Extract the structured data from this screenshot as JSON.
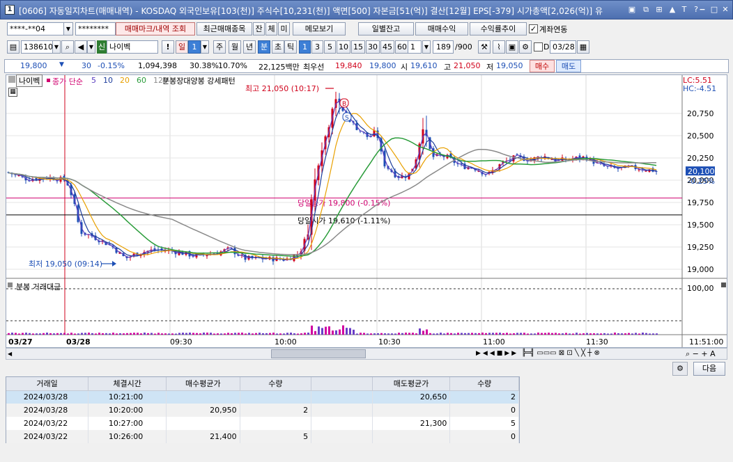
{
  "window": {
    "number": "1",
    "title": "[0606] 자동일지차트(매매내역) - KOSDAQ 외국인보유[103(천)] 주식수[10,231(천)] 액면[500] 자본금[51(억)] 결산[12월] EPS[-379] 시가총액[2,026(억)] 유"
  },
  "toolbar1": {
    "account": "****-**04",
    "password": "********",
    "mark_btn": "매매마크/내역 조회",
    "recent_btn": "최근매매종목",
    "jan": "잔",
    "che": "체",
    "mi": "미",
    "memo": "메모보기",
    "daily_balance": "일별잔고",
    "trade_profit": "매매수익",
    "profit_trend": "수익률추이",
    "account_link": "계좌연동"
  },
  "toolbar2": {
    "code": "138610",
    "credit": "신",
    "stock_name": "나이벡",
    "alert": "!",
    "il": "일",
    "il_num": "1",
    "ju": "주",
    "wol": "월",
    "nyeon": "년",
    "bun": "분",
    "cho": "초",
    "tik": "틱",
    "periods": [
      "1",
      "3",
      "5",
      "10",
      "15",
      "30",
      "45",
      "60"
    ],
    "period_sel": "1",
    "count": "189",
    "count_total": "/900",
    "d_label": "D",
    "date": "03/28"
  },
  "quote": {
    "price": "19,800",
    "change_arrow": "▼",
    "change": "30",
    "rate": "-0.15%",
    "volume": "1,094,398",
    "turnover_rate": "30.38%",
    "vol_power": "10.70%",
    "amount": "22,125백만",
    "best_label": "최우선",
    "best_ask": "19,840",
    "best_bid": "19,800",
    "open_label": "시",
    "open": "19,610",
    "high_label": "고",
    "high": "21,050",
    "low_label": "저",
    "low": "19,050",
    "buy": "매수",
    "sell": "매도"
  },
  "chart": {
    "name_tag": "나이벡",
    "legend_close": "종가 단순",
    "ma": [
      {
        "label": "5",
        "color": "#5a3cc0"
      },
      {
        "label": "10",
        "color": "#1c3c9c"
      },
      {
        "label": "20",
        "color": "#e8a000"
      },
      {
        "label": "60",
        "color": "#2a9c3a"
      },
      {
        "label": "120",
        "color": "#8a8a8a"
      }
    ],
    "pattern": "분봉장대양봉 강세패턴",
    "lc": "LC:5.51",
    "hc": "HC:-4.51",
    "high_note": "최고 21,050 (10:17)",
    "low_note": "최저 19,050 (09:14)",
    "close_note": "당일종가 19,800 (-0.15%)",
    "open_note": "당일시가 19,610 (-1.11%)",
    "y_ticks": [
      "20,750",
      "20,500",
      "20,250",
      "20,000",
      "19,750",
      "19,500",
      "19,250",
      "19,000"
    ],
    "cur_price": "20,100",
    "cur_rate": "-0.25%",
    "vol_title": "분봉 거래대금",
    "vol_tick": "100,00",
    "x_labels": [
      "03/27",
      "03/28",
      "09:30",
      "10:00",
      "10:30",
      "11:00",
      "11:30",
      "11:51:00"
    ],
    "buy_mark": "B",
    "sell_mark": "S",
    "colors": {
      "up": "#d0021b",
      "down": "#1d4fb5",
      "close_line": "#d0006f",
      "open_line": "#000000"
    }
  },
  "bottom": {
    "next": "다음"
  },
  "table": {
    "headers": [
      "거래일",
      "체결시간",
      "매수평균가",
      "수량",
      "",
      "매도평균가",
      "수량"
    ],
    "rows": [
      [
        "2024/03/28",
        "10:21:00",
        "",
        "",
        "",
        "20,650",
        "2"
      ],
      [
        "2024/03/28",
        "10:20:00",
        "20,950",
        "2",
        "",
        "",
        "0"
      ],
      [
        "2024/03/22",
        "10:27:00",
        "",
        "",
        "",
        "21,300",
        "5"
      ],
      [
        "2024/03/22",
        "10:26:00",
        "21,400",
        "5",
        "",
        "",
        "0"
      ]
    ]
  }
}
